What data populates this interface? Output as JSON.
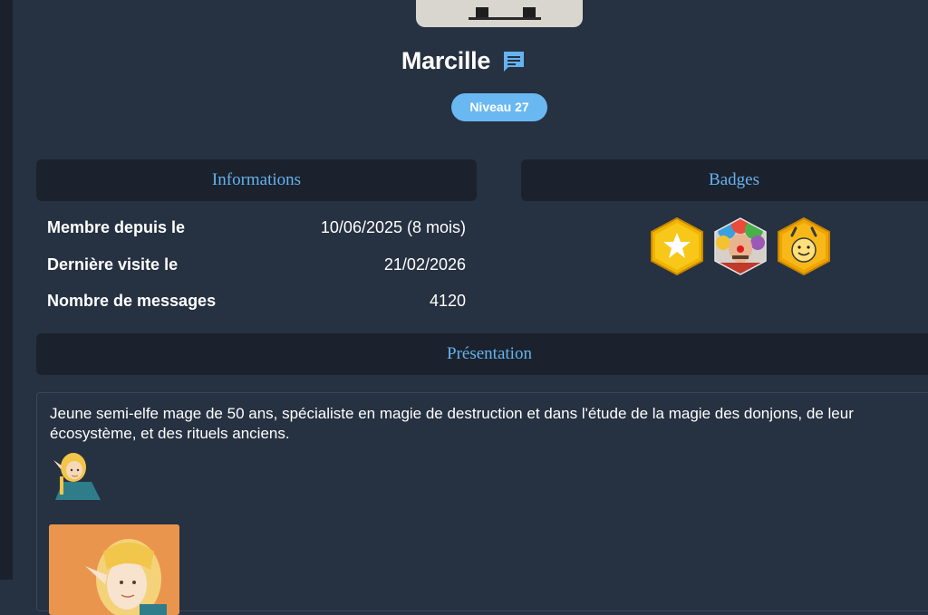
{
  "profile": {
    "name": "Marcille",
    "level": "Niveau 27"
  },
  "sections": {
    "informations": "Informations",
    "badges": "Badges",
    "presentation": "Présentation"
  },
  "info": [
    {
      "label": "Membre depuis le",
      "value": "10/06/2025 (8 mois)"
    },
    {
      "label": "Dernière visite le",
      "value": "21/02/2026"
    },
    {
      "label": "Nombre de messages",
      "value": "4120"
    }
  ],
  "badges": [
    {
      "icon": "gold-star-badge-icon"
    },
    {
      "icon": "clown-badge-icon"
    },
    {
      "icon": "happy-face-badge-icon"
    }
  ],
  "presentation": {
    "text": "Jeune semi-elfe mage de 50 ans, spécialiste en magie de destruction et dans l'étude de la magie des donjons, de leur écosystème, et des rituels anciens."
  },
  "colors": {
    "background": "#263141",
    "panel": "#1b222d",
    "accent": "#65b2ee",
    "level_badge": "#6ab8f2"
  }
}
